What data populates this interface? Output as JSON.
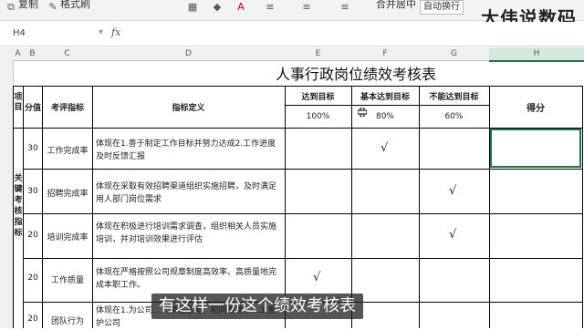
{
  "toolbar": {
    "items": [
      "复制",
      "格式刷"
    ],
    "merge_label": "合并居中",
    "wrap_label": "自动换行"
  },
  "formula_bar": {
    "cell_ref": "H4",
    "fx": "fx",
    "value": ""
  },
  "watermark": "大伟说数码",
  "subtitle": "有这样一份这个绩效考核表",
  "columns": [
    "A",
    "B",
    "C",
    "D",
    "E",
    "F",
    "G",
    "H"
  ],
  "sheet": {
    "title": "人事行政岗位绩效考核表",
    "headers": {
      "item": "项目",
      "score_value": "分值",
      "indicator": "考评指标",
      "definition": "指标定义",
      "reach": "达到目标",
      "basic_reach": "基本达到目标",
      "not_reach": "不能达到目标",
      "score": "得分"
    },
    "percentages": [
      "100%",
      "80%",
      "60%"
    ],
    "category_label": "关键考核指标",
    "rows": [
      {
        "value": "30",
        "indicator": "工作完成率",
        "definition": "体现在1.善于制定工作目标并努力达成2.工作进度及时反馈汇报",
        "check": "F"
      },
      {
        "value": "30",
        "indicator": "招聘完成率",
        "definition": "体现在采取有效招聘渠道组织实施招聘，及时满足用人部门岗位需求",
        "check": "G"
      },
      {
        "value": "20",
        "indicator": "培训完成率",
        "definition": "体现在积极进行培训需求调查，组织相关人员实施培训，并对培训效果进行评估",
        "check": "G"
      },
      {
        "value": "20",
        "indicator": "工作质量",
        "definition": "体现在严格按照公司规章制度高效率、高质量地完成本职工作。",
        "check": "E"
      },
      {
        "value": "20",
        "indicator": "团队行为",
        "definition": "体现在1.为公司……换位思考、和同事建……3.爱护公司",
        "check": ""
      }
    ],
    "check_mark": "√"
  },
  "colors": {
    "accent": "#217346",
    "header_bg": "#eef0f2"
  }
}
